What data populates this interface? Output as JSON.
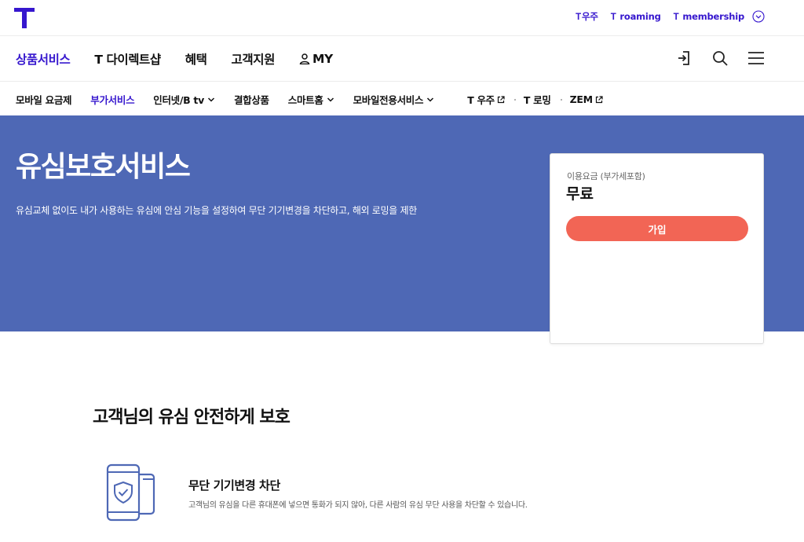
{
  "brand": {
    "logo_letter": "T",
    "accent": "#3617ce"
  },
  "top_links": [
    {
      "t": "T",
      "label": "우주"
    },
    {
      "t": "T",
      "label": "roaming"
    },
    {
      "t": "T",
      "label": "membership"
    }
  ],
  "main_nav": {
    "items": [
      "상품서비스",
      "T 다이렉트샵",
      "혜택",
      "고객지원",
      "MY"
    ],
    "active_index": 0,
    "icons": [
      "login-icon",
      "search-icon",
      "menu-icon"
    ]
  },
  "sub_nav": {
    "items": [
      {
        "label": "모바일 요금제"
      },
      {
        "label": "부가서비스"
      },
      {
        "label": "인터넷/B tv"
      },
      {
        "label": "결합상품"
      },
      {
        "label": "스마트홈"
      },
      {
        "label": "모바일전용서비스"
      },
      {
        "label": "T 우주"
      },
      {
        "label": "T 로밍"
      },
      {
        "label": "ZEM"
      }
    ],
    "active_index": 1
  },
  "hero": {
    "title": "유심보호서비스",
    "description": "유심교체 없이도 내가 사용하는 유심에 안심 기능을 설정하여 무단 기기변경을 차단하고, 해외 로밍을 제한",
    "background": "#4e68b5"
  },
  "price_card": {
    "label": "이용요금 (부가세포함)",
    "price": "무료",
    "join_label": "가입",
    "button_color": "#f26555"
  },
  "section": {
    "title": "고객님의 유심 안전하게 보호",
    "feature": {
      "icon": "phone-shield-icon",
      "title": "무단 기기변경 차단",
      "description": "고객님의 유심을 다른 휴대폰에 넣으면 통화가 되지 않아, 다른 사람의 유심 무단 사용을 차단할 수 있습니다."
    }
  }
}
